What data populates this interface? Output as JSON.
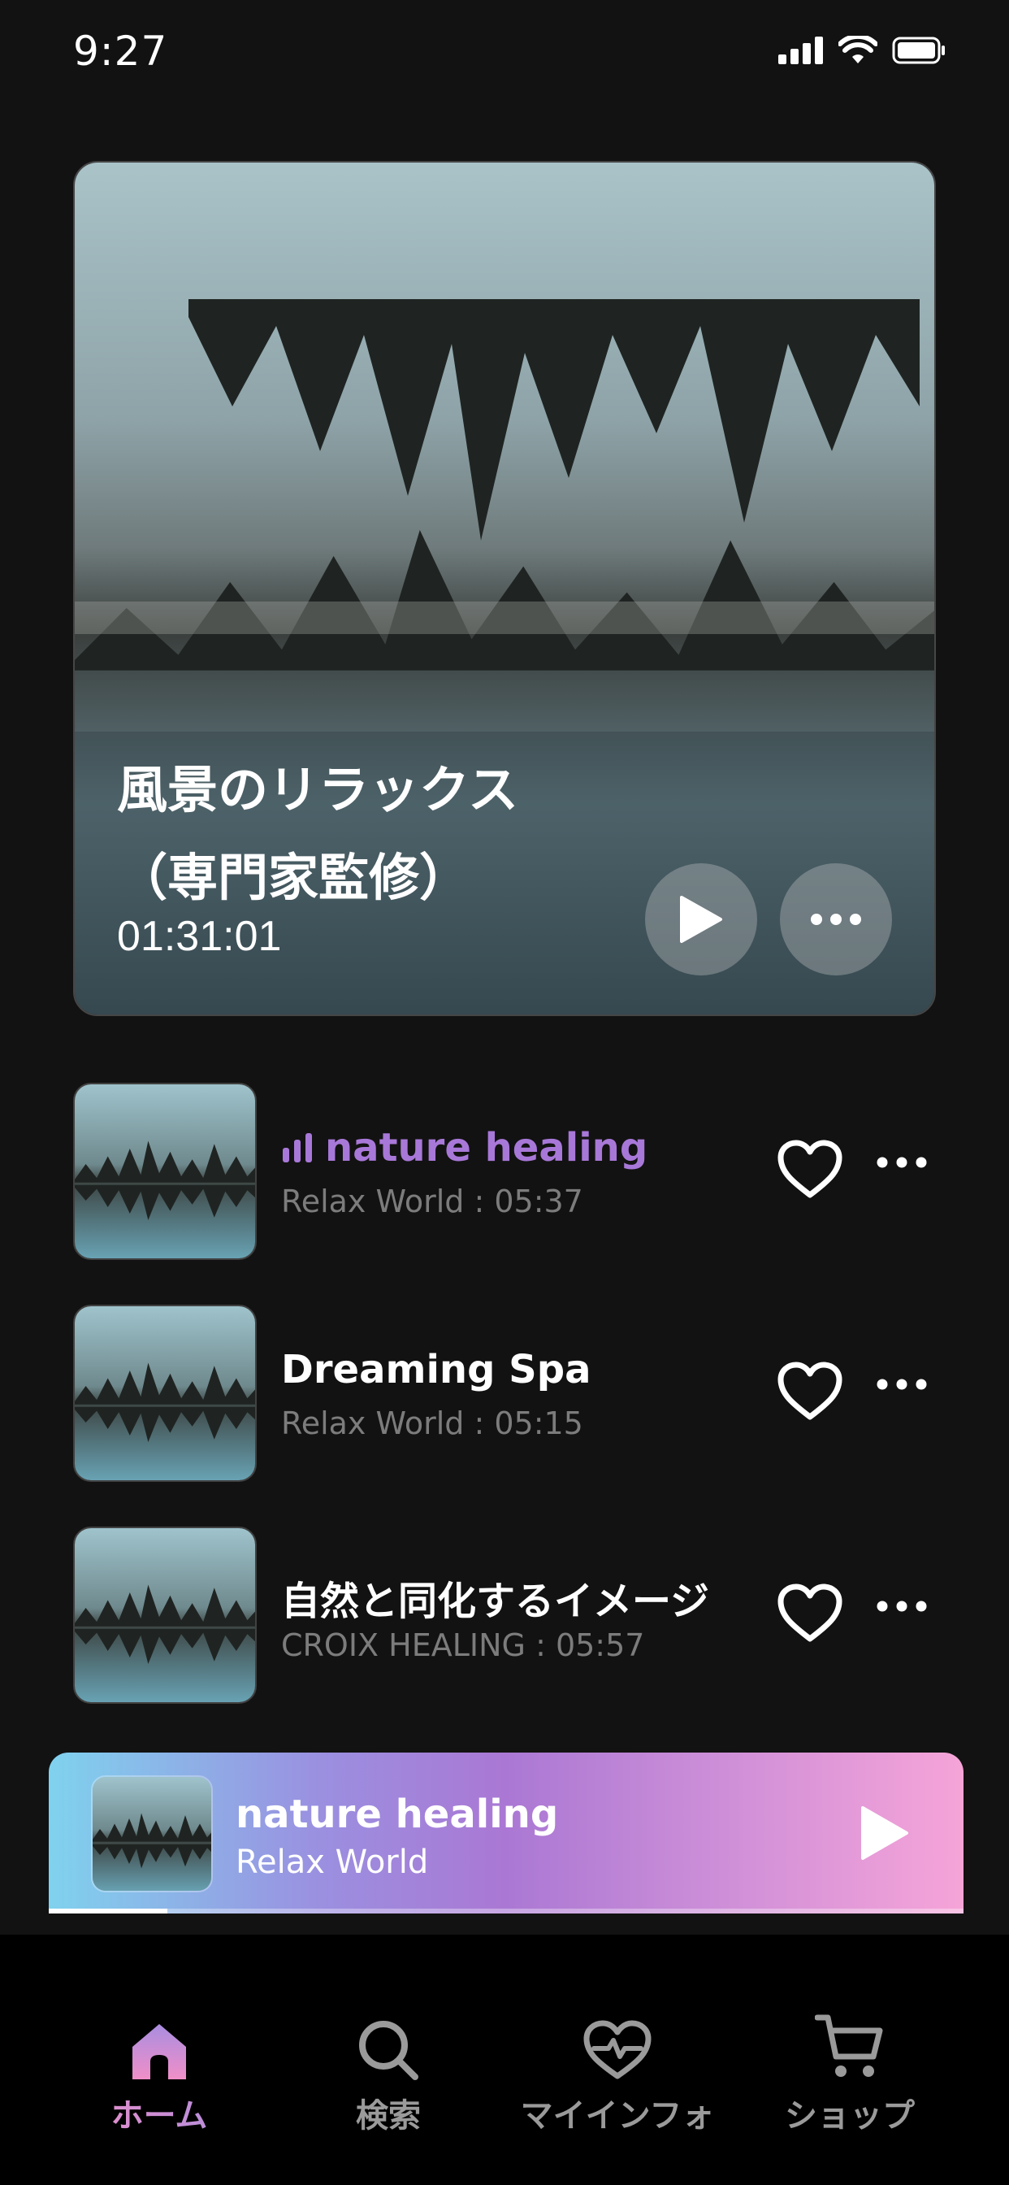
{
  "status_bar": {
    "time": "9:27"
  },
  "hero": {
    "title": "風景のリラックス\n（専門家監修）",
    "duration": "01:31:01"
  },
  "tracks": [
    {
      "title": "nature healing",
      "subtitle": "Relax World : 05:37",
      "playing": true
    },
    {
      "title": "Dreaming Spa",
      "subtitle": "Relax World : 05:15",
      "playing": false
    },
    {
      "title": "自然と同化するイメージ",
      "subtitle": "CROIX HEALING : 05:57",
      "playing": false
    }
  ],
  "mini_player": {
    "title": "nature healing",
    "artist": "Relax World",
    "progress": 0.13
  },
  "tabs": [
    {
      "label": "ホーム",
      "icon": "home-icon",
      "active": true
    },
    {
      "label": "検索",
      "icon": "search-icon",
      "active": false
    },
    {
      "label": "マイインフォ",
      "icon": "heart-pulse-icon",
      "active": false
    },
    {
      "label": "ショップ",
      "icon": "cart-icon",
      "active": false
    }
  ],
  "colors": {
    "accent": "#a878d8",
    "background": "#121212",
    "tabbar": "#000000"
  }
}
